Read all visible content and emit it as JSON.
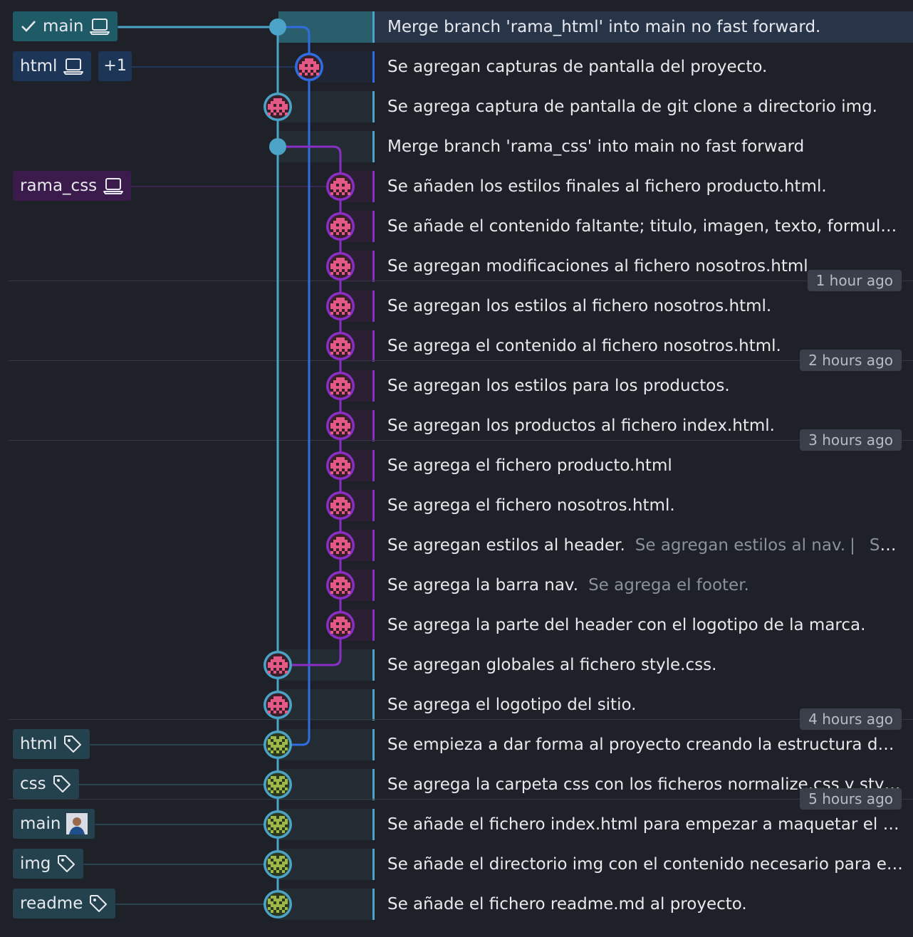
{
  "colors": {
    "main_lane": "#4ba3c7",
    "html_lane": "#2f6de1",
    "css_lane": "#8a2fc6",
    "main_label_bg": "#1f5a67",
    "html_label_bg": "#1d3556",
    "css_label_bg": "#3a1b4b",
    "tag_bg": "#23424e"
  },
  "commits": [
    {
      "message": "Merge branch 'rama_html' into main no fast forward.",
      "lane": "main",
      "merge": true,
      "highlighted": true
    },
    {
      "message": "Se agregan capturas de pantalla del proyecto.",
      "lane": "html"
    },
    {
      "message": "Se agrega captura de pantalla de git clone a directorio img.",
      "lane": "main"
    },
    {
      "message": "Merge branch 'rama_css' into main no fast forward",
      "lane": "main",
      "merge": true
    },
    {
      "message": "Se añaden los estilos finales al fichero producto.html.",
      "lane": "css"
    },
    {
      "message": "Se añade el contenido faltante; titulo, imagen, texto, formulario...",
      "lane": "css"
    },
    {
      "message": "Se agregan modificaciones al fichero nosotros.html",
      "lane": "css"
    },
    {
      "message": "Se agregan los estilos al fichero nosotros.html.",
      "lane": "css"
    },
    {
      "message": "Se agrega el contenido al fichero nosotros.html.",
      "lane": "css"
    },
    {
      "message": "Se agregan los estilos para los productos.",
      "lane": "css"
    },
    {
      "message": "Se agregan los productos al fichero index.html.",
      "lane": "css"
    },
    {
      "message": "Se agrega el fichero producto.html",
      "lane": "css"
    },
    {
      "message": "Se agrega el fichero nosotros.html.",
      "lane": "css"
    },
    {
      "message": "Se agregan estilos al header.",
      "extra": "Se agregan estilos al nav.",
      "extra2": "Se ag...",
      "lane": "css"
    },
    {
      "message": "Se agrega la barra nav.",
      "extra": "Se agrega el footer.",
      "lane": "css"
    },
    {
      "message": "Se agrega la parte del header con el logotipo de la marca.",
      "lane": "css"
    },
    {
      "message": "Se agregan globales al fichero style.css.",
      "lane": "main"
    },
    {
      "message": "Se agrega el logotipo del sitio.",
      "lane": "main"
    },
    {
      "message": "Se empieza a dar forma al proyecto creando la estructura de H...",
      "lane": "main",
      "avatar": "green"
    },
    {
      "message": "Se agrega la carpeta css con los ficheros normalize.css y style.css",
      "lane": "main",
      "avatar": "green"
    },
    {
      "message": "Se añade el fichero index.html para empezar a maquetar el siti...",
      "lane": "main",
      "avatar": "green"
    },
    {
      "message": "Se añade el directorio img con el contenido necesario para el d...",
      "lane": "main",
      "avatar": "green"
    },
    {
      "message": "Se añade el fichero readme.md al proyecto.",
      "lane": "main",
      "avatar": "green"
    }
  ],
  "refs": [
    {
      "row": 0,
      "label": "main",
      "kind": "local-current",
      "lane": "main"
    },
    {
      "row": 1,
      "label": "html",
      "kind": "local",
      "lane": "html",
      "plus": "+1"
    },
    {
      "row": 4,
      "label": "rama_css",
      "kind": "local",
      "lane": "css"
    },
    {
      "row": 18,
      "label": "html",
      "kind": "tag"
    },
    {
      "row": 19,
      "label": "css",
      "kind": "tag"
    },
    {
      "row": 20,
      "label": "main",
      "kind": "remote-avatar"
    },
    {
      "row": 21,
      "label": "img",
      "kind": "tag"
    },
    {
      "row": 22,
      "label": "readme",
      "kind": "tag"
    }
  ],
  "time_markers": [
    {
      "label": "1 hour ago",
      "before_row": 7
    },
    {
      "label": "2 hours ago",
      "before_row": 9
    },
    {
      "label": "3 hours ago",
      "before_row": 11
    },
    {
      "label": "4 hours ago",
      "before_row": 18
    },
    {
      "label": "5 hours ago",
      "before_row": 20
    }
  ]
}
